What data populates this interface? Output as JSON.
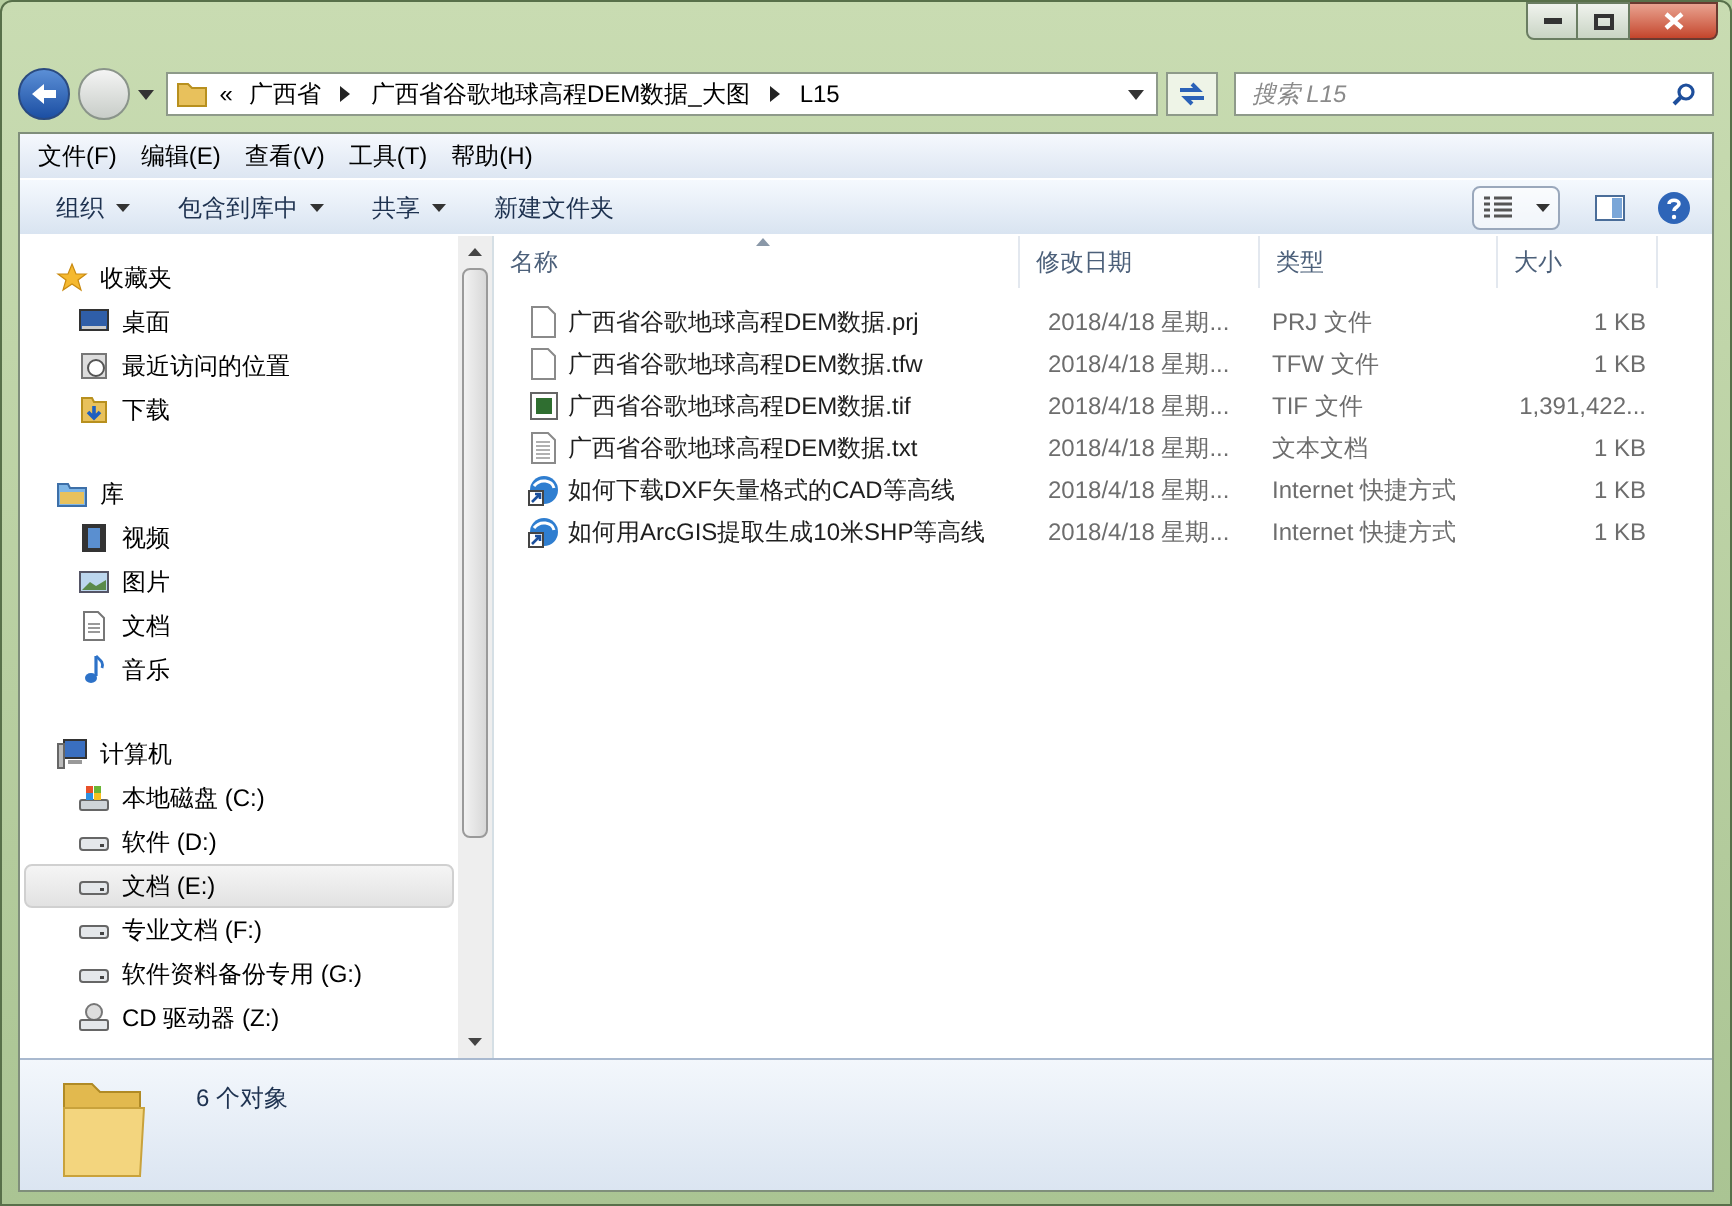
{
  "address": {
    "overflow": "«",
    "crumbs": [
      "广西省",
      "广西省谷歌地球高程DEM数据_大图",
      "L15"
    ]
  },
  "search": {
    "placeholder": "搜索 L15"
  },
  "menu": [
    "文件(F)",
    "编辑(E)",
    "查看(V)",
    "工具(T)",
    "帮助(H)"
  ],
  "toolbar": [
    {
      "label": "组织",
      "dropdown": true
    },
    {
      "label": "包含到库中",
      "dropdown": true
    },
    {
      "label": "共享",
      "dropdown": true
    },
    {
      "label": "新建文件夹",
      "dropdown": false
    }
  ],
  "nav": [
    {
      "label": "收藏夹",
      "children": [
        {
          "label": "桌面",
          "selected": false
        },
        {
          "label": "最近访问的位置",
          "selected": false
        },
        {
          "label": "下载",
          "selected": false
        }
      ]
    },
    {
      "label": "库",
      "children": [
        {
          "label": "视频",
          "selected": false
        },
        {
          "label": "图片",
          "selected": false
        },
        {
          "label": "文档",
          "selected": false
        },
        {
          "label": "音乐",
          "selected": false
        }
      ]
    },
    {
      "label": "计算机",
      "children": [
        {
          "label": "本地磁盘 (C:)",
          "selected": false
        },
        {
          "label": "软件 (D:)",
          "selected": false
        },
        {
          "label": "文档 (E:)",
          "selected": true
        },
        {
          "label": "专业文档 (F:)",
          "selected": false
        },
        {
          "label": "软件资料备份专用 (G:)",
          "selected": false
        },
        {
          "label": "CD 驱动器 (Z:)",
          "selected": false
        }
      ]
    }
  ],
  "columns": [
    {
      "label": "名称",
      "sorted": true
    },
    {
      "label": "修改日期",
      "sorted": false
    },
    {
      "label": "类型",
      "sorted": false
    },
    {
      "label": "大小",
      "sorted": false
    }
  ],
  "files": [
    {
      "name": "广西省谷歌地球高程DEM数据.prj",
      "kind": "file",
      "date": "2018/4/18 星期...",
      "type": "PRJ 文件",
      "size": "1 KB"
    },
    {
      "name": "广西省谷歌地球高程DEM数据.tfw",
      "kind": "file",
      "date": "2018/4/18 星期...",
      "type": "TFW 文件",
      "size": "1 KB"
    },
    {
      "name": "广西省谷歌地球高程DEM数据.tif",
      "kind": "image",
      "date": "2018/4/18 星期...",
      "type": "TIF 文件",
      "size": "1,391,422..."
    },
    {
      "name": "广西省谷歌地球高程DEM数据.txt",
      "kind": "text",
      "date": "2018/4/18 星期...",
      "type": "文本文档",
      "size": "1 KB"
    },
    {
      "name": "如何下载DXF矢量格式的CAD等高线",
      "kind": "shortcut",
      "date": "2018/4/18 星期...",
      "type": "Internet 快捷方式",
      "size": "1 KB"
    },
    {
      "name": "如何用ArcGIS提取生成10米SHP等高线",
      "kind": "shortcut",
      "date": "2018/4/18 星期...",
      "type": "Internet 快捷方式",
      "size": "1 KB"
    }
  ],
  "details": {
    "count": "6 个对象"
  }
}
